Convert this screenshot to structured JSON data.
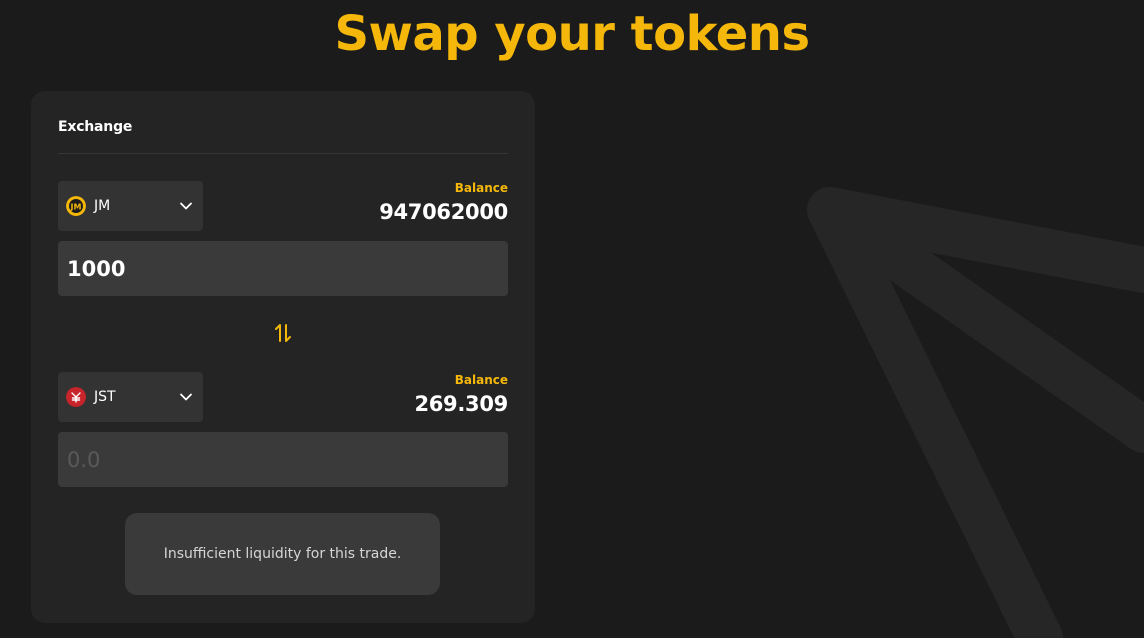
{
  "page": {
    "title": "Swap your tokens"
  },
  "exchange": {
    "header": "Exchange",
    "from": {
      "token": "JM",
      "logo_icon": "jm-token-logo",
      "balance_label": "Balance",
      "balance": "947062000",
      "amount": "1000",
      "placeholder": "0.0"
    },
    "to": {
      "token": "JST",
      "logo_icon": "jst-token-logo",
      "balance_label": "Balance",
      "balance": "269.309",
      "amount": "",
      "placeholder": "0.0"
    },
    "swap_icon": "swap-arrows-icon",
    "status_message": "Insufficient liquidity for this trade."
  },
  "colors": {
    "accent": "#f5b80a",
    "background": "#1b1b1b",
    "card": "#242424",
    "input": "#3a3a3a",
    "select": "#333333"
  }
}
